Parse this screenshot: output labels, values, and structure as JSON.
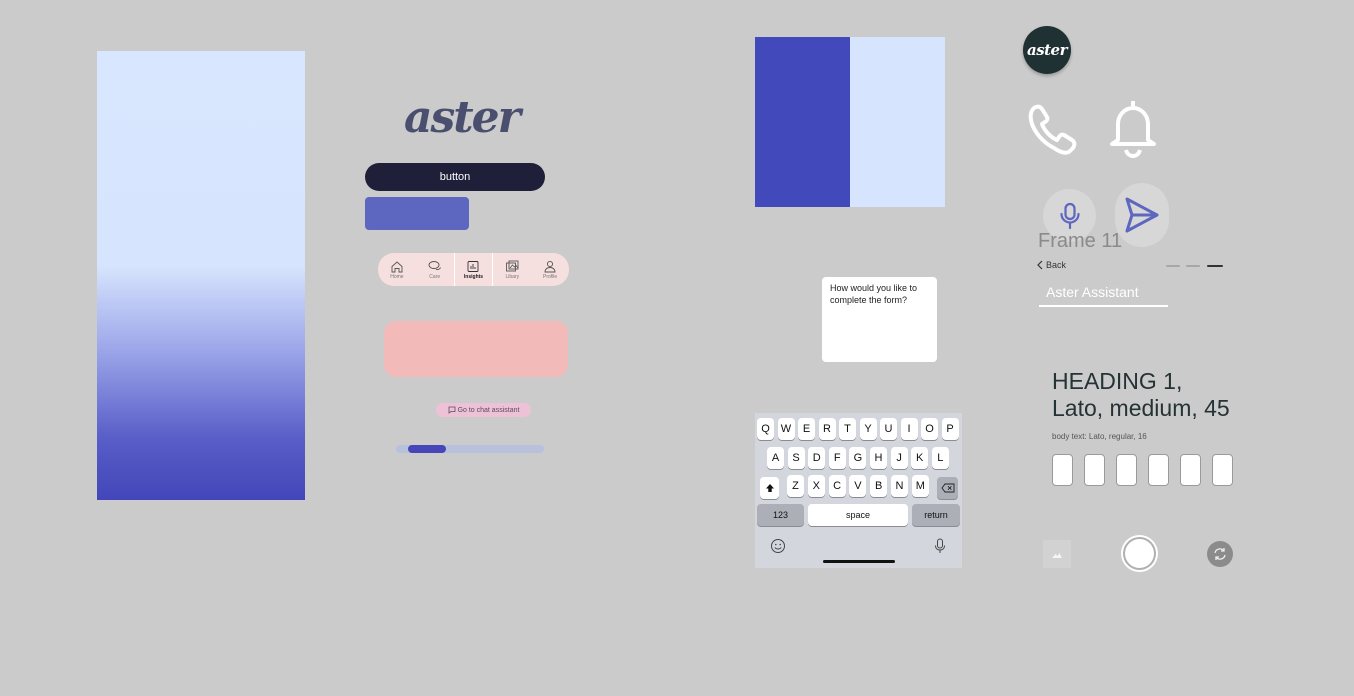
{
  "brand": {
    "logo_text": "aster",
    "avatar_text": "aster"
  },
  "colors": {
    "background": "#cbcbcb",
    "primary_dark": "#1f1f3a",
    "primary_purple": "#5d67c0",
    "indigo": "#4249bb",
    "light_blue": "#d6e4fd",
    "pink": "#f3baba",
    "dark_teal": "#1f3133"
  },
  "components": {
    "button_label": "button",
    "chat_chip_label": "Go to chat assistant",
    "progress_fraction": 0.26
  },
  "tabbar": {
    "items": [
      {
        "label": "Home",
        "icon": "home-icon"
      },
      {
        "label": "Care",
        "icon": "chat-bubbles-icon"
      },
      {
        "label": "Insights",
        "icon": "bar-chart-icon",
        "active": true
      },
      {
        "label": "Libary",
        "icon": "image-gallery-icon"
      },
      {
        "label": "Profile",
        "icon": "person-icon"
      }
    ]
  },
  "question_card": {
    "text": "How would you like to complete the form?"
  },
  "keyboard": {
    "row1": [
      "Q",
      "W",
      "E",
      "R",
      "T",
      "Y",
      "U",
      "I",
      "O",
      "P"
    ],
    "row2": [
      "A",
      "S",
      "D",
      "F",
      "G",
      "H",
      "J",
      "K",
      "L"
    ],
    "row3": [
      "Z",
      "X",
      "C",
      "V",
      "B",
      "N",
      "M"
    ],
    "numbers_label": "123",
    "space_label": "space",
    "return_label": "return"
  },
  "frame": {
    "title": "Frame 11",
    "back_label": "Back",
    "assistant_value": "Aster Assistant",
    "step_current": 3,
    "step_total": 3
  },
  "typography": {
    "heading_line1": "HEADING 1,",
    "heading_line2": "Lato, medium, 45",
    "body_sample": "body text: Lato, regular, 16"
  },
  "otp": {
    "box_count": 6
  }
}
